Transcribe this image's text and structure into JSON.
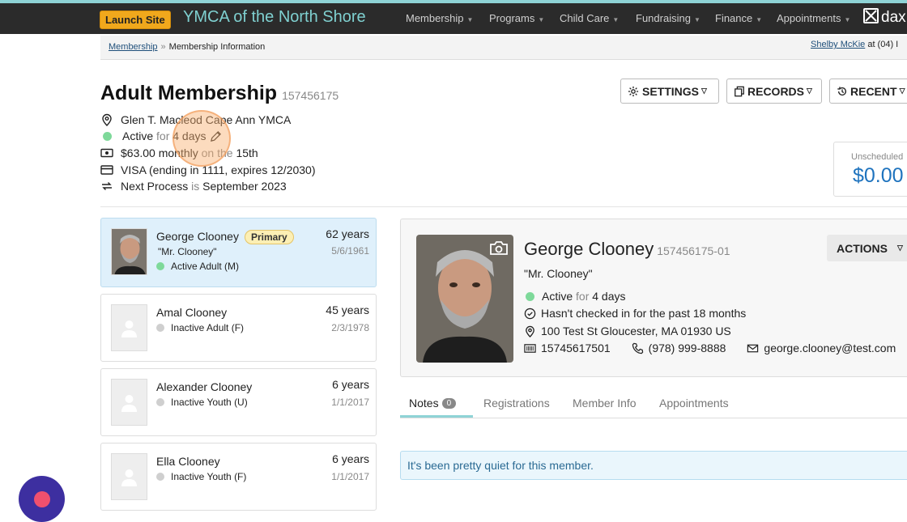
{
  "nav": {
    "launch_label": "Launch Site",
    "brand": "YMCA of the North Shore",
    "items": [
      "Membership",
      "Programs",
      "Child Care",
      "Fundraising",
      "Finance",
      "Appointments"
    ],
    "logo_text": "dax"
  },
  "breadcrumb": {
    "link": "Membership",
    "separator": "»",
    "current": "Membership Information",
    "user_name": "Shelby McKie",
    "user_suffix": " at (04) I"
  },
  "membership": {
    "title": "Adult Membership",
    "number": "157456175",
    "location": "Glen T. Macleod Cape Ann YMCA",
    "status": "Active",
    "status_for": "for",
    "status_duration": "4 days",
    "price": "$63.00 monthly",
    "price_on": "on the",
    "price_day": "15th",
    "payment": "VISA (ending in 1111, expires 12/2030)",
    "next_label": "Next Process",
    "next_is": "is",
    "next_date": "September 2023"
  },
  "header_buttons": {
    "settings": "SETTINGS",
    "records": "RECORDS",
    "recent": "RECENT"
  },
  "unscheduled": {
    "label": "Unscheduled",
    "amount": "$0.00"
  },
  "members": [
    {
      "name": "George Clooney",
      "badge": "Primary",
      "nickname": "\"Mr. Clooney\"",
      "status": "Active Adult (M)",
      "age": "62 years",
      "dob": "5/6/1961"
    },
    {
      "name": "Amal Clooney",
      "status": "Inactive Adult (F)",
      "age": "45 years",
      "dob": "2/3/1978"
    },
    {
      "name": "Alexander Clooney",
      "status": "Inactive Youth (U)",
      "age": "6 years",
      "dob": "1/1/2017"
    },
    {
      "name": "Ella Clooney",
      "status": "Inactive Youth (F)",
      "age": "6 years",
      "dob": "1/1/2017"
    }
  ],
  "detail": {
    "name": "George Clooney",
    "member_id": "157456175-01",
    "nickname": "\"Mr. Clooney\"",
    "status": "Active",
    "status_for": "for",
    "status_duration": "4 days",
    "checkin": "Hasn't checked in for the past 18 months",
    "address": "100 Test St Gloucester, MA 01930 US",
    "barcode": "15745617501",
    "phone": "(978) 999-8888",
    "email": "george.clooney@test.com",
    "actions_label": "ACTIONS"
  },
  "tabs": {
    "notes": "Notes",
    "notes_count": "0",
    "registrations": "Registrations",
    "member_info": "Member Info",
    "appointments": "Appointments"
  },
  "notes_message": "It's been pretty quiet for this member.",
  "colors": {
    "nav_bg": "#2b2b2b",
    "brand": "#7fd0d0",
    "launch": "#f0a81c",
    "active_dot": "#7ed99a",
    "selected_card": "#dff0fb",
    "amount": "#1e73be"
  }
}
